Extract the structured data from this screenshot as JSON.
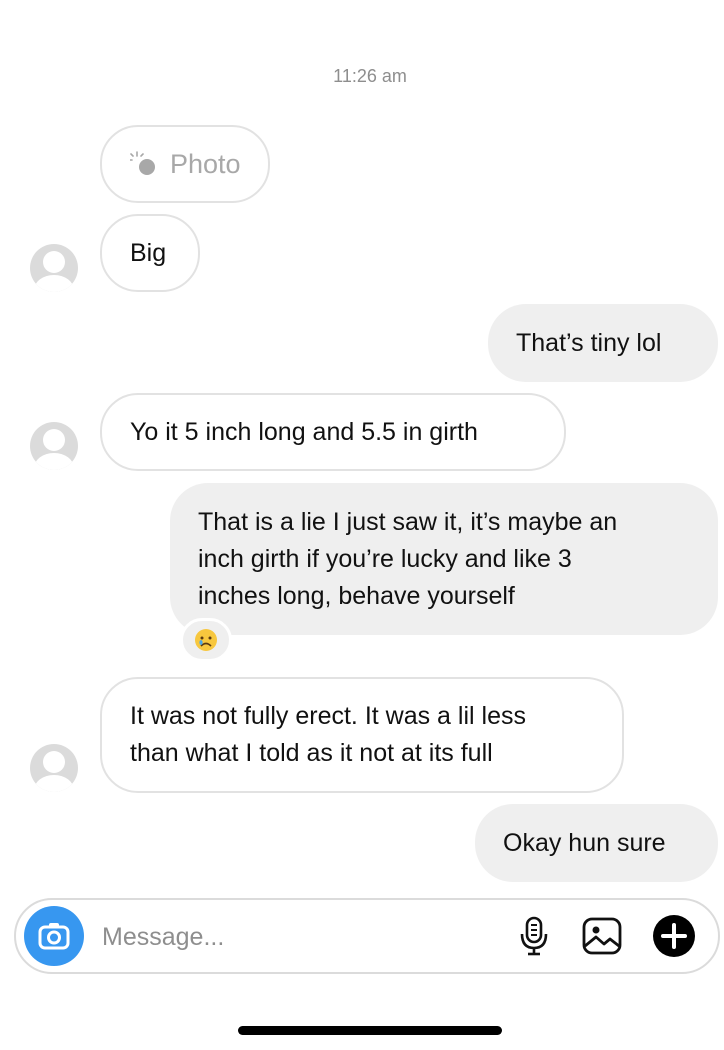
{
  "chat": {
    "timestamp": "11:26 am",
    "photo_label": "Photo",
    "messages": [
      {
        "from": "them",
        "text": "Big"
      },
      {
        "from": "me",
        "text": "That’s tiny lol"
      },
      {
        "from": "them",
        "text": "Yo it 5 inch long and 5.5 in girth"
      },
      {
        "from": "me",
        "lines": [
          "That is a lie I just saw it, it’s maybe an",
          "inch girth if you’re lucky and like 3",
          "inches long, behave yourself"
        ],
        "reaction": "crying-face-emoji"
      },
      {
        "from": "them",
        "lines": [
          "It was not fully erect. It was a lil less",
          "than what I told as it not at its full"
        ]
      },
      {
        "from": "me",
        "text": "Okay hun sure"
      }
    ]
  },
  "composer": {
    "placeholder": "Message...",
    "camera_icon": "camera-icon",
    "mic_icon": "microphone-icon",
    "gallery_icon": "gallery-icon",
    "add_icon": "plus-icon"
  },
  "colors": {
    "accent": "#3797f0",
    "outgoing_bubble": "#efefef",
    "incoming_border": "#e2e2e2"
  }
}
